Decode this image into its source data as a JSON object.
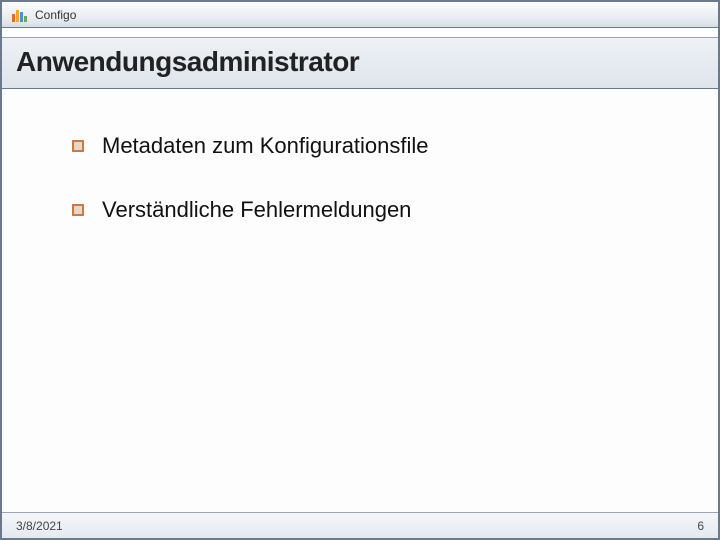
{
  "brand": "Configo",
  "title": "Anwendungsadministrator",
  "bullets": [
    "Metadaten zum Konfigurationsfile",
    "Verständliche Fehlermeldungen"
  ],
  "footer": {
    "date": "3/8/2021",
    "page": "6"
  }
}
